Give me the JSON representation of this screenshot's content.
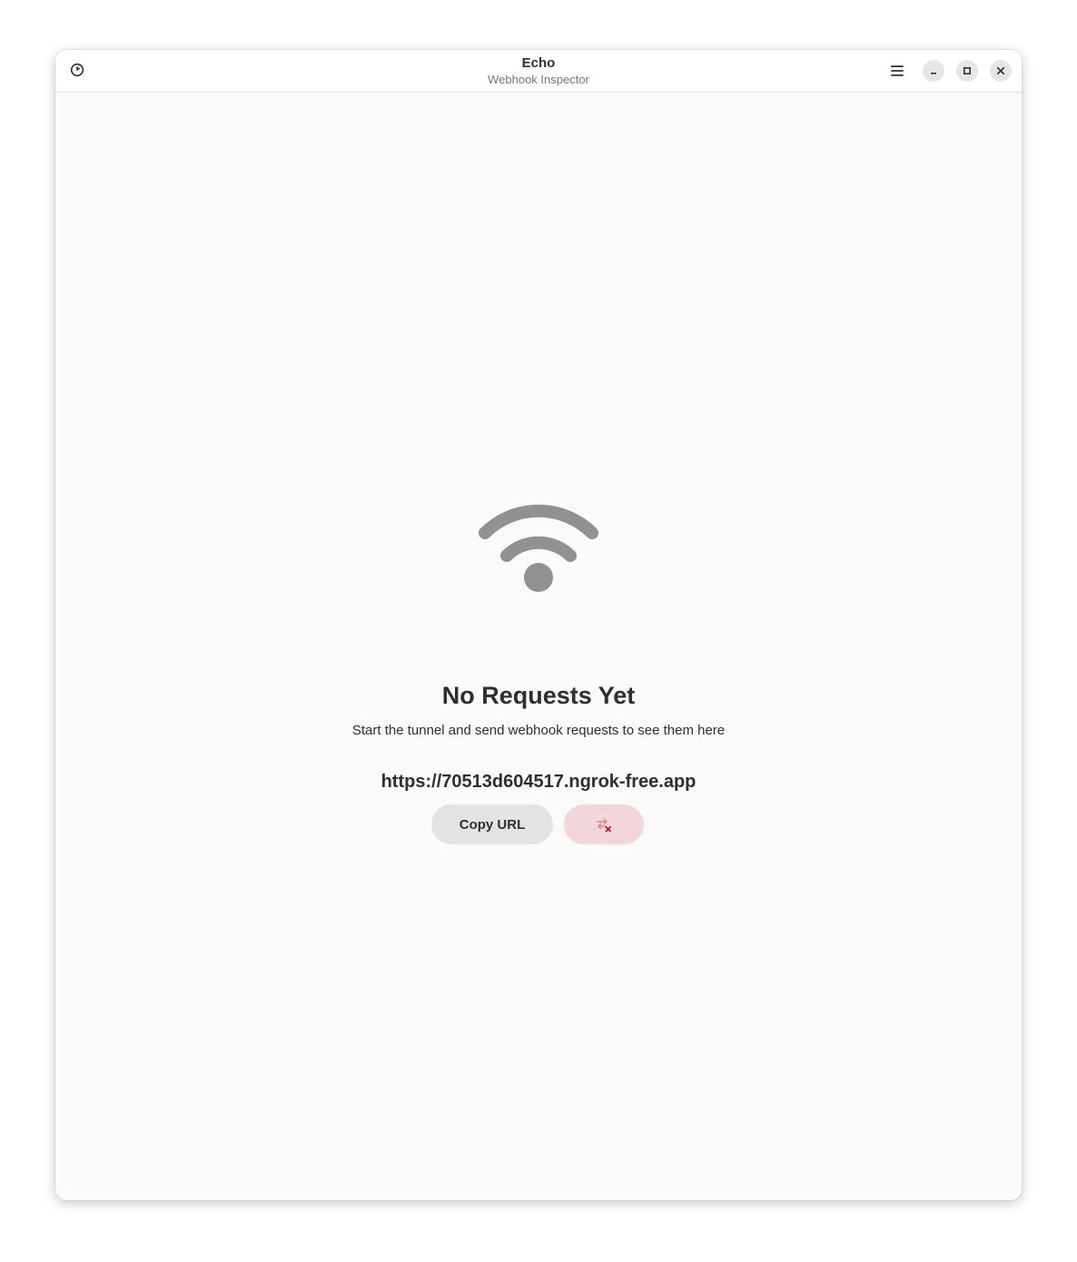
{
  "window": {
    "title": "Echo",
    "subtitle": "Webhook Inspector"
  },
  "headerbar": {
    "history_icon": "clock-history-icon",
    "menu_icon": "hamburger-menu-icon",
    "minimize_icon": "minimize-icon",
    "maximize_icon": "maximize-icon",
    "close_icon": "close-icon"
  },
  "empty_state": {
    "icon": "wifi-signal-icon",
    "title": "No Requests Yet",
    "description": "Start the tunnel and send webhook requests to see them here",
    "url": "https://70513d604517.ngrok-free.app",
    "copy_button_label": "Copy URL",
    "stop_tunnel_icon": "stop-tunnel-icon"
  },
  "colors": {
    "window_bg": "#fafafa",
    "text": "#2e2e33",
    "icon_gray": "#919194",
    "destructive_bg": "#f3d6d9",
    "destructive_fg": "#c01c28"
  }
}
